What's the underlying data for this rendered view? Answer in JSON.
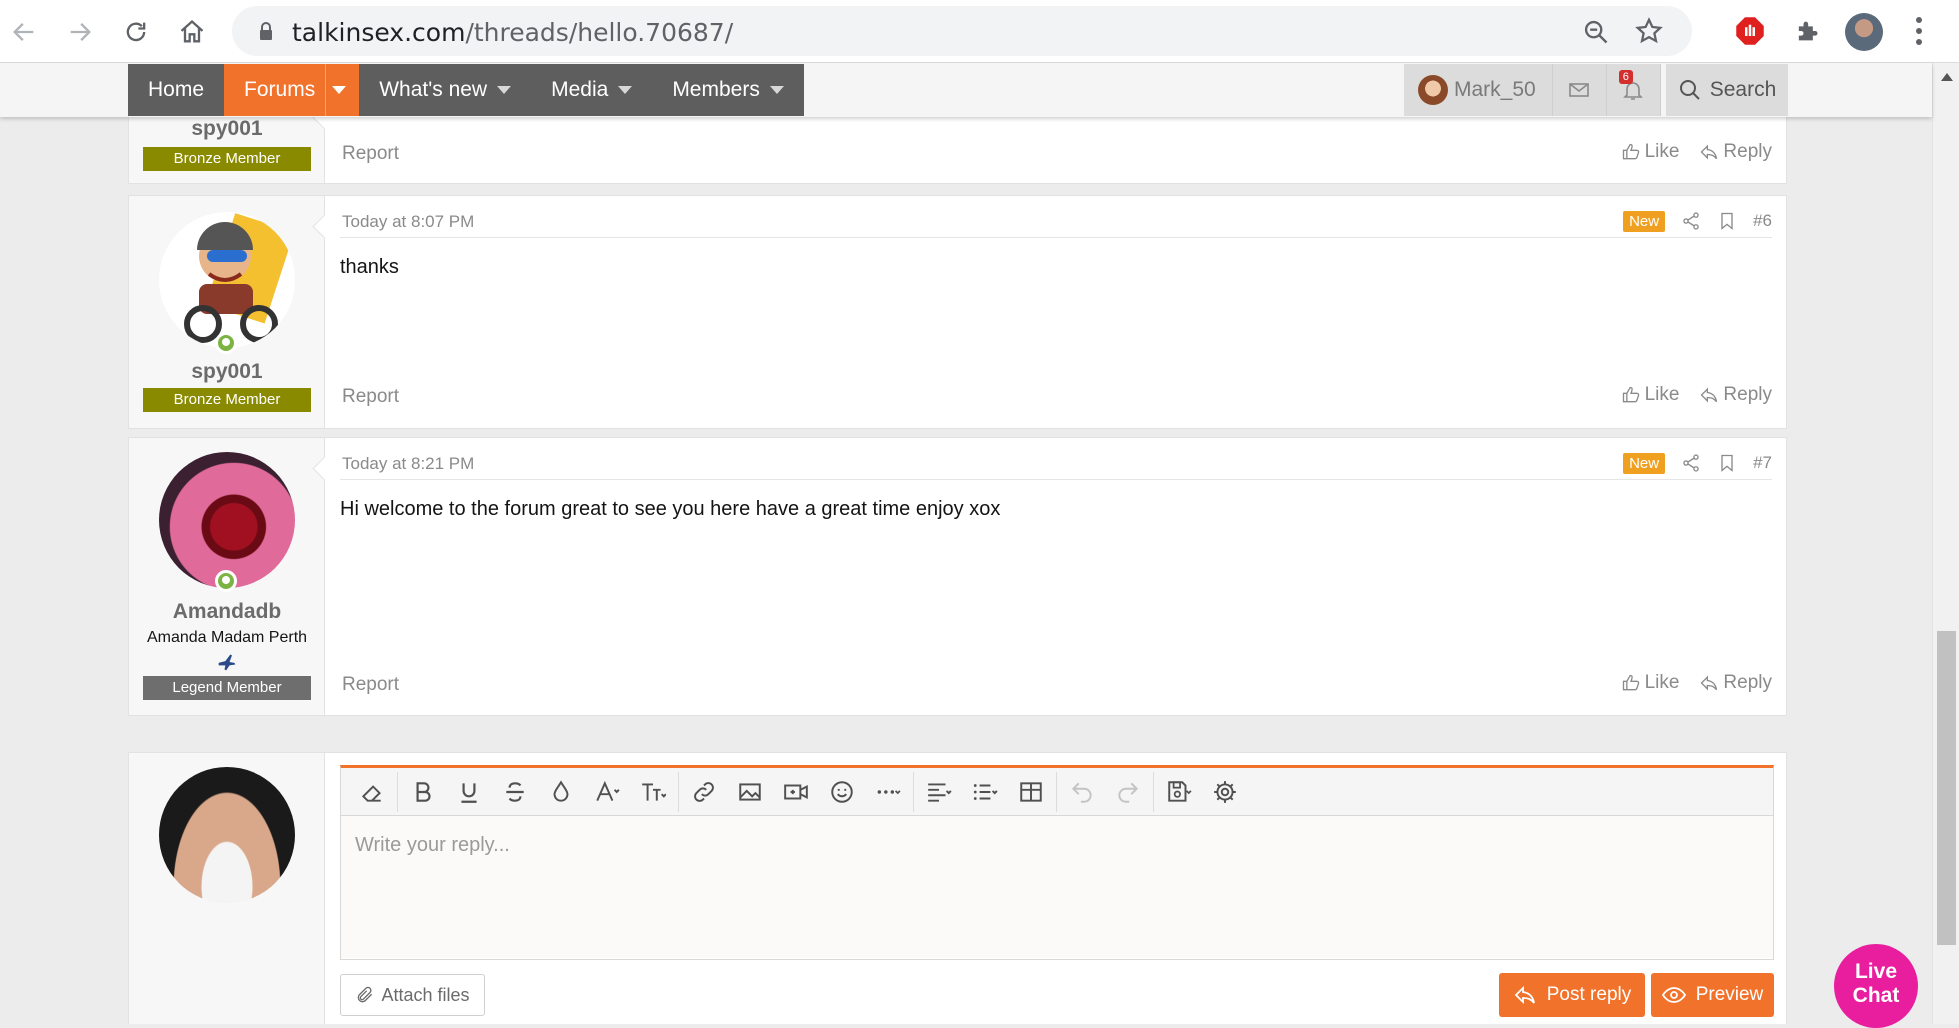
{
  "browser": {
    "url_domain": "talkinsex.com",
    "url_path": "/threads/hello.70687/"
  },
  "nav": {
    "home": "Home",
    "forums": "Forums",
    "whats_new": "What's new",
    "media": "Media",
    "members": "Members",
    "username": "Mark_50",
    "notification_count": "6",
    "search": "Search"
  },
  "posts": [
    {
      "username": "spy001",
      "banner": "Bronze Member",
      "report": "Report",
      "like": "Like",
      "reply": "Reply"
    },
    {
      "username": "spy001",
      "banner": "Bronze Member",
      "date": "Today at 8:07 PM",
      "new_badge": "New",
      "number": "#6",
      "body": "thanks",
      "report": "Report",
      "like": "Like",
      "reply": "Reply"
    },
    {
      "username": "Amandadb",
      "user_title": "Amanda Madam Perth",
      "banner": "Legend Member",
      "date": "Today at 8:21 PM",
      "new_badge": "New",
      "number": "#7",
      "body": "Hi welcome to the forum great to see you here have a great time enjoy xox",
      "report": "Report",
      "like": "Like",
      "reply": "Reply"
    }
  ],
  "reply_box": {
    "placeholder": "Write your reply...",
    "attach_files": "Attach files",
    "post_reply": "Post reply",
    "preview": "Preview"
  },
  "live_chat": {
    "line1": "Live",
    "line2": "Chat"
  },
  "colors": {
    "accent": "#f0722b",
    "bronze": "#8a8a00",
    "legend": "#6e6e6e",
    "online": "#7cb342",
    "live_chat": "#e91e9e"
  }
}
